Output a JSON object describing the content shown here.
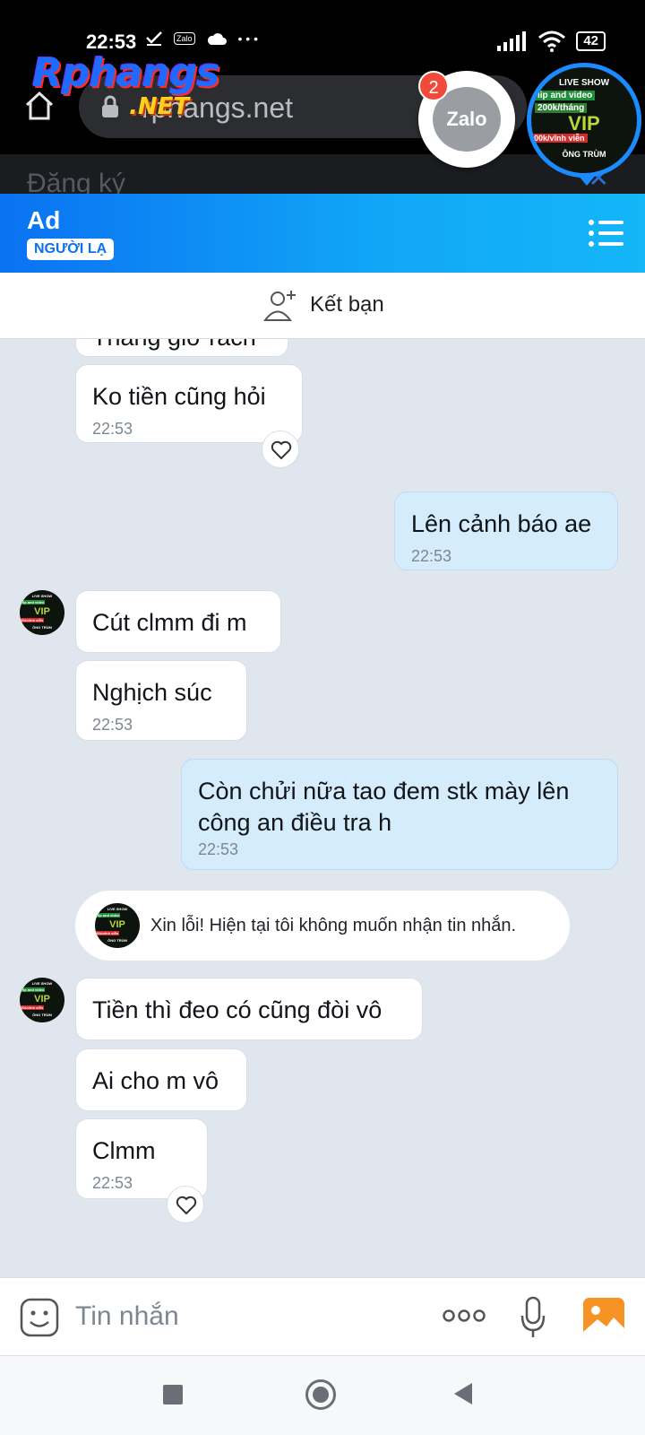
{
  "status_bar": {
    "time": "22:53",
    "battery": "42",
    "icons": [
      "check-icon",
      "zalo-notification-icon",
      "cloud-icon",
      "more-dots-icon",
      "signal-icon",
      "wifi-icon",
      "battery-icon"
    ],
    "zalo_glyph": "Zalo",
    "dots": "• • •"
  },
  "browser": {
    "url": "rphangs.net",
    "watermark_brand": "Rphangs",
    "watermark_tld": ".NET",
    "behind_text": "Đăng ký",
    "close_glyph": "✕"
  },
  "floating": {
    "zalo_label": "Zalo",
    "unread_count": "2",
    "avatar_lines": {
      "live_show": "LIVE SHOW",
      "clip_video": "lip and video",
      "price_month": "200k/tháng",
      "vip": "VIP",
      "price_forever": "00k/vĩnh viễn",
      "owner": "ÔNG TRÙM"
    }
  },
  "header": {
    "contact_name": "Ad",
    "stranger_label": "NGƯỜI LẠ",
    "add_friend_label": "Kết bạn"
  },
  "messages": {
    "partial_top": "Thằng giờ rách",
    "m1": {
      "text": "Ko tiền cũng hỏi",
      "time": "22:53"
    },
    "m2": {
      "text": "Lên cảnh báo ae",
      "time": "22:53"
    },
    "m3": {
      "text": "Cút clmm đi m"
    },
    "m4": {
      "text": "Nghịch súc",
      "time": "22:53"
    },
    "m5": {
      "text": "Còn chửi nữa tao đem stk mày lên công an điều tra h",
      "time": "22:53"
    },
    "system": "Xin lỗi! Hiện tại tôi không muốn nhận tin nhắn.",
    "m6": {
      "text": "Tiền thì đeo có cũng đòi vô"
    },
    "m7": {
      "text": "Ai cho m vô"
    },
    "m8": {
      "text": "Clmm",
      "time": "22:53"
    }
  },
  "input": {
    "placeholder": "Tin nhắn"
  },
  "colors": {
    "header_start": "#0a72f2",
    "header_end": "#14b6f8",
    "my_bubble": "#d4ecfc",
    "badge": "#f04a3b",
    "image_button": "#f79225"
  }
}
